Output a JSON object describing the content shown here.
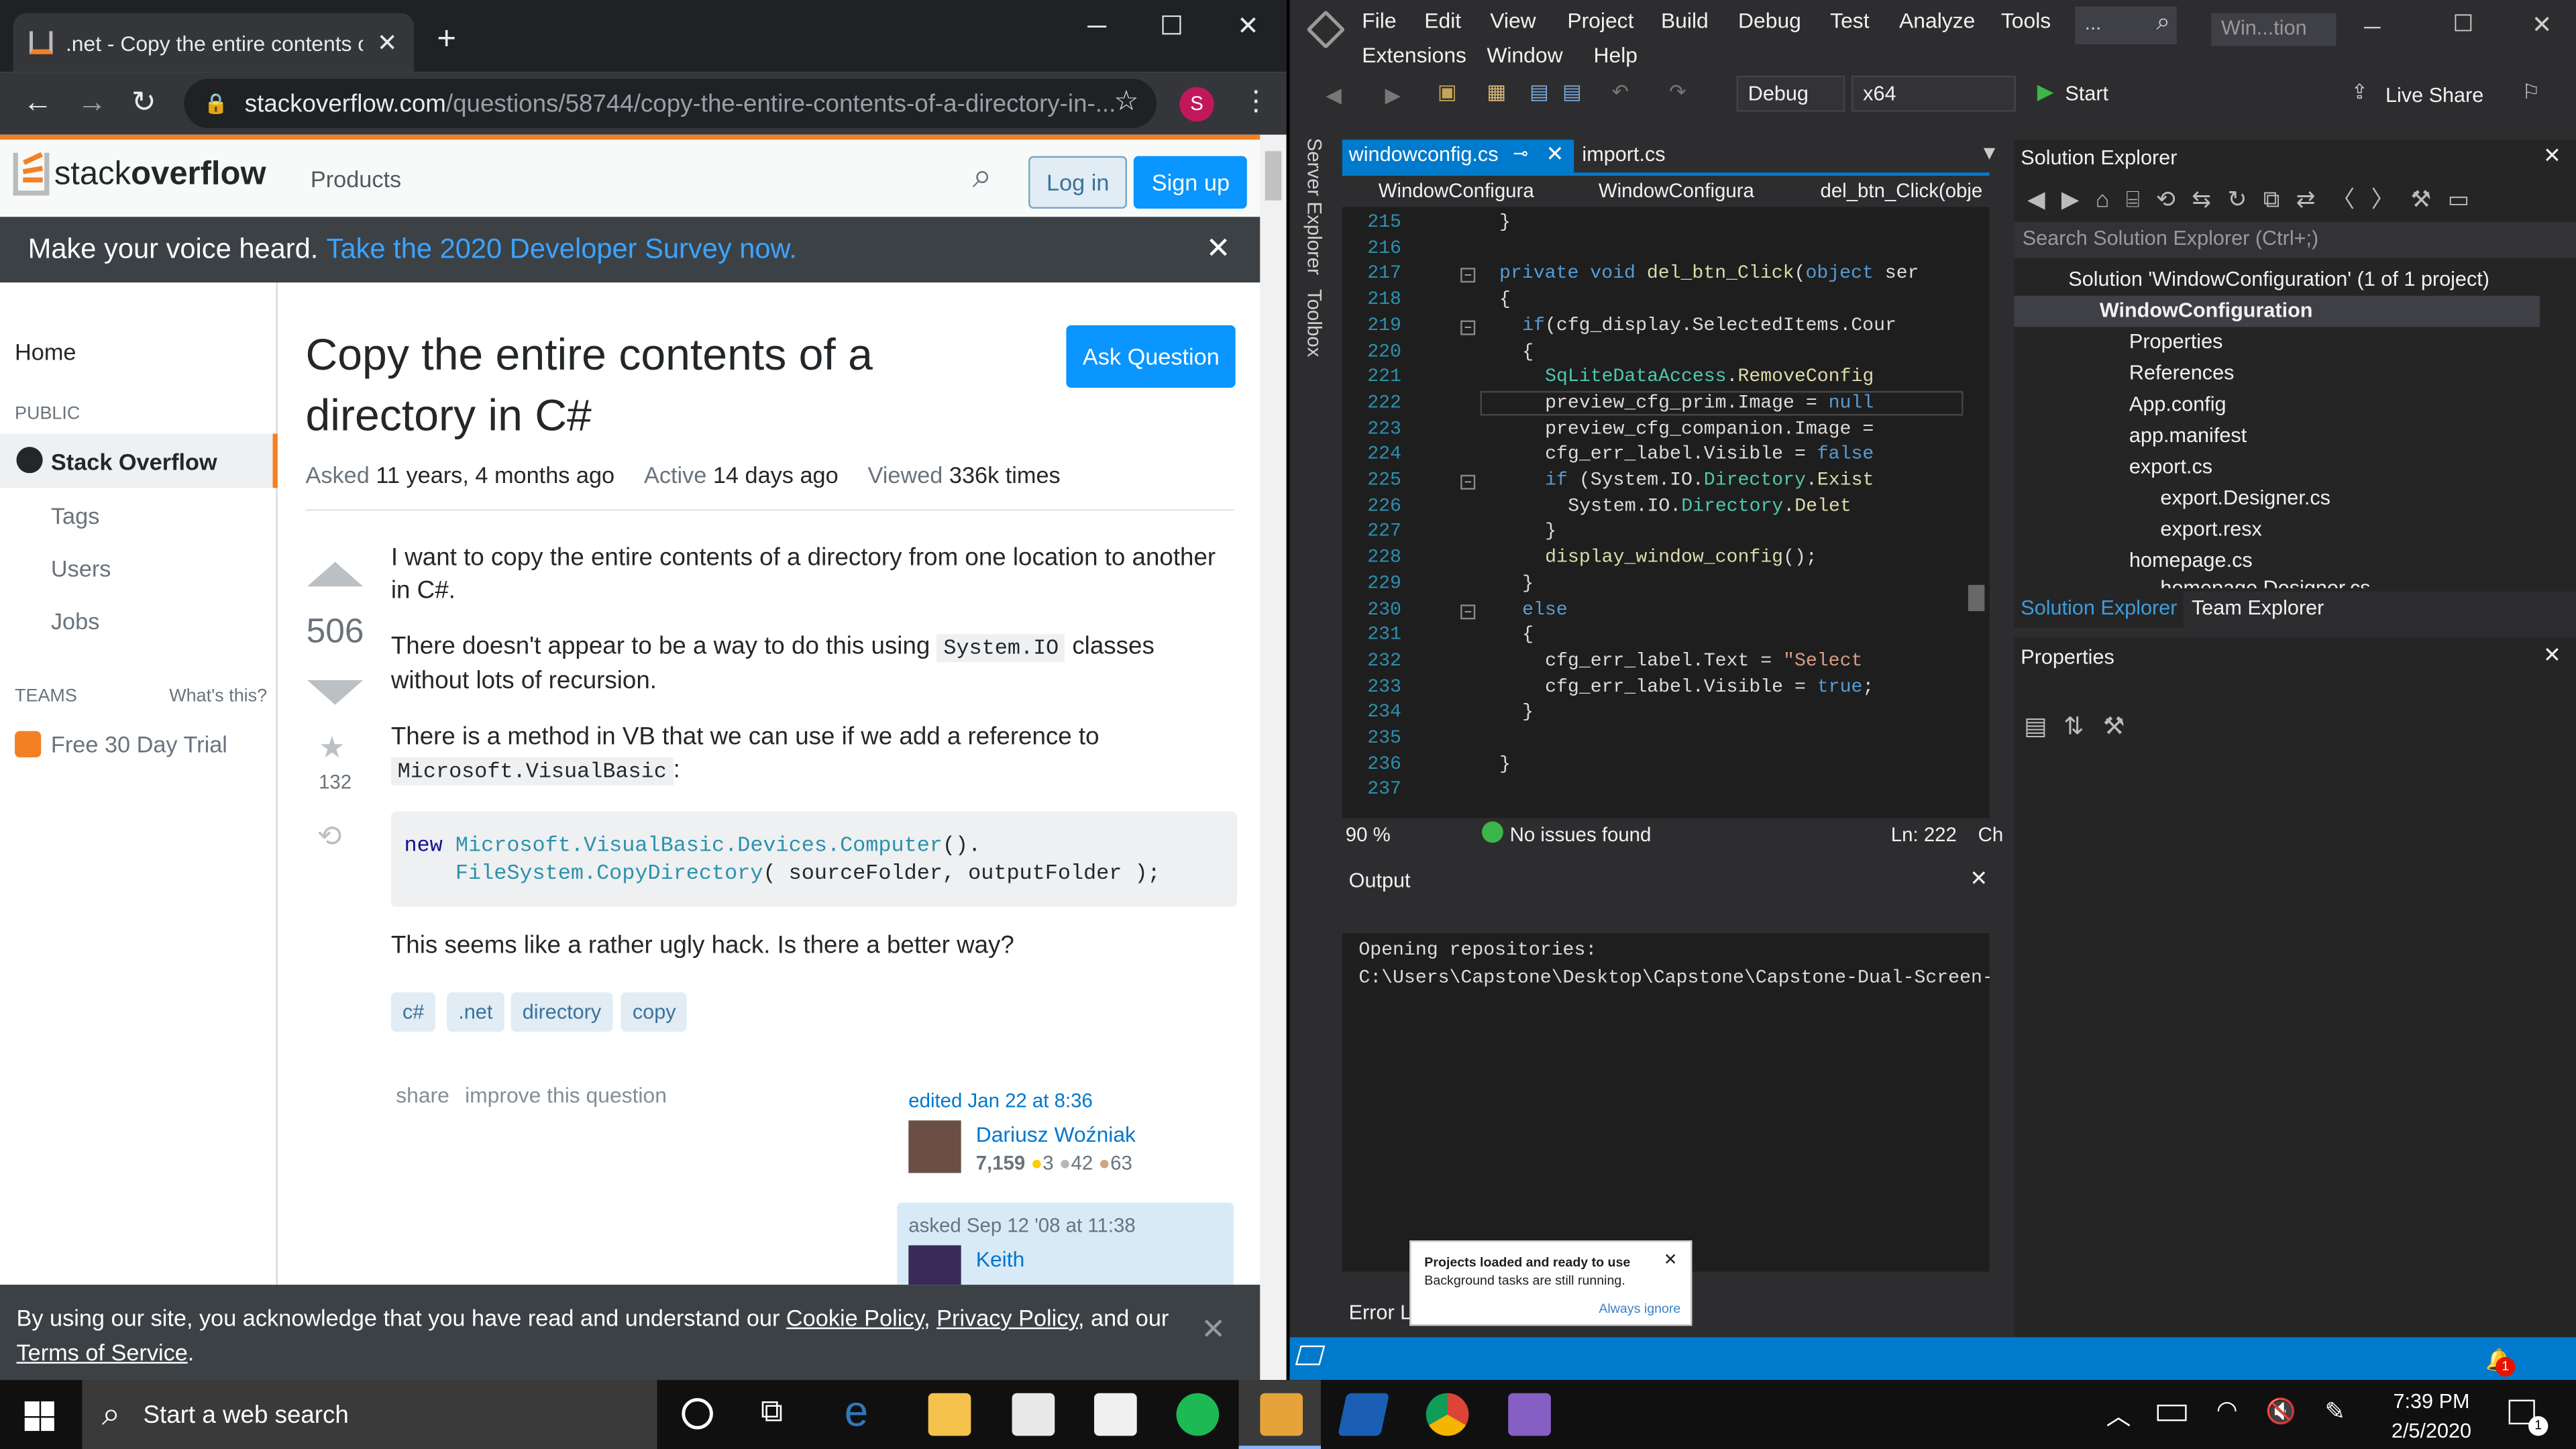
{
  "chrome": {
    "tab_title": ".net - Copy the entire contents of",
    "url_domain": "stackoverflow.com",
    "url_path": "/questions/58744/copy-the-entire-contents-of-a-directory-in-...",
    "profile_initial": "S"
  },
  "so": {
    "logo_light": "stack",
    "logo_bold": "overflow",
    "products": "Products",
    "login": "Log in",
    "signup": "Sign up",
    "banner_text": "Make your voice heard.",
    "banner_link": "Take the 2020 Developer Survey now.",
    "nav": {
      "home": "Home",
      "public": "PUBLIC",
      "stack_overflow": "Stack Overflow",
      "tags": "Tags",
      "users": "Users",
      "jobs": "Jobs",
      "teams": "TEAMS",
      "whats_this": "What's this?",
      "trial": "Free 30 Day Trial"
    },
    "question": {
      "title_line1": "Copy the entire contents of a",
      "title_line2": "directory in C#",
      "ask_button": "Ask Question",
      "asked_label": "Asked",
      "asked_value": "11 years, 4 months ago",
      "active_label": "Active",
      "active_value": "14 days ago",
      "viewed_label": "Viewed",
      "viewed_value": "336k times",
      "votes": "506",
      "favorites": "132",
      "p1": "I want to copy the entire contents of a directory from one location to another in C#.",
      "p2a": "There doesn't appear to be a way to do this using",
      "p2code": "System.IO",
      "p2b": "classes without lots of recursion.",
      "p3": "There is a method in VB that we can use if we add a reference to",
      "p3code": "Microsoft.VisualBasic",
      "p3end": ":",
      "code_new": "new",
      "code_ns": "Microsoft.VisualBasic.Devices.Computer",
      "code_l1end": "().",
      "code_fs": "FileSystem.CopyDirectory",
      "code_l2end": "( sourceFolder, outputFolder );",
      "p4": "This seems like a rather ugly hack. Is there a better way?",
      "tags": [
        "c#",
        ".net",
        "directory",
        "copy"
      ],
      "share": "share",
      "improve": "improve this question",
      "edited": "edited Jan 22 at 8:36",
      "editor_name": "Dariusz Woźniak",
      "editor_rep": "7,159",
      "editor_gold": "3",
      "editor_silver": "42",
      "editor_bronze": "63",
      "asked_on": "asked Sep 12 '08 at 11:38",
      "asker_name": "Keith"
    },
    "cookie": {
      "prefix": "By using our site, you acknowledge that you have read and understand our",
      "cookie_policy": "Cookie Policy",
      "privacy_policy": "Privacy Policy",
      "and_our": ", and our",
      "terms": "Terms of Service",
      "end": "."
    }
  },
  "vs": {
    "menu": [
      "File",
      "Edit",
      "View",
      "Project",
      "Build",
      "Debug",
      "Test",
      "Analyze",
      "Tools"
    ],
    "menu2": [
      "Extensions",
      "Window",
      "Help"
    ],
    "search_box": "...",
    "window_title": "Win...tion",
    "config": "Debug",
    "platform": "x64",
    "start": "Start",
    "live_share": "Live Share",
    "side_tabs": [
      "Server Explorer",
      "Toolbox"
    ],
    "tabs": [
      {
        "label": "windowconfig.cs",
        "active": true
      },
      {
        "label": "import.cs",
        "active": false
      }
    ],
    "nav_bar": [
      "WindowConfigura",
      "WindowConfigura",
      "del_btn_Click(obje"
    ],
    "code": [
      {
        "n": "215",
        "t": "}"
      },
      {
        "n": "216",
        "t": ""
      },
      {
        "n": "217",
        "t": "private void del_btn_Click(object ser"
      },
      {
        "n": "218",
        "t": "{"
      },
      {
        "n": "219",
        "t": "if(cfg_display.SelectedItems.Cour"
      },
      {
        "n": "220",
        "t": "{"
      },
      {
        "n": "221",
        "t": "SqLiteDataAccess.RemoveConfig"
      },
      {
        "n": "222",
        "t": "preview_cfg_prim.Image = null"
      },
      {
        "n": "223",
        "t": "preview_cfg_companion.Image ="
      },
      {
        "n": "224",
        "t": "cfg_err_label.Visible = false"
      },
      {
        "n": "225",
        "t": "if (System.IO.Directory.Exist"
      },
      {
        "n": "226",
        "t": "System.IO.Directory.Delet"
      },
      {
        "n": "227",
        "t": "}"
      },
      {
        "n": "228",
        "t": "display_window_config();"
      },
      {
        "n": "229",
        "t": "}"
      },
      {
        "n": "230",
        "t": "else"
      },
      {
        "n": "231",
        "t": "{"
      },
      {
        "n": "232",
        "t": "cfg_err_label.Text = \"Select"
      },
      {
        "n": "233",
        "t": "cfg_err_label.Visible = true;"
      },
      {
        "n": "234",
        "t": "}"
      },
      {
        "n": "235",
        "t": ""
      },
      {
        "n": "236",
        "t": "}"
      },
      {
        "n": "237",
        "t": ""
      }
    ],
    "zoom": "90 %",
    "issues": "No issues found",
    "line_col": "Ln: 222",
    "ch": "Ch",
    "output_title": "Output",
    "output_line1": "Opening repositories:",
    "output_line2": "C:\\Users\\Capstone\\Desktop\\Capstone\\Capstone-Dual-Screen-A",
    "error_list": "Error L",
    "toast_title": "Projects loaded and ready to use",
    "toast_body": "Background tasks are still running.",
    "toast_link": "Always ignore",
    "se_title": "Solution Explorer",
    "se_search": "Search Solution Explorer (Ctrl+;)",
    "se_tree": {
      "solution": "Solution 'WindowConfiguration' (1 of 1 project)",
      "project": "WindowConfiguration",
      "properties": "Properties",
      "references": "References",
      "app_config": "App.config",
      "app_manifest": "app.manifest",
      "export_cs": "export.cs",
      "export_designer": "export.Designer.cs",
      "export_resx": "export.resx",
      "homepage_cs": "homepage.cs",
      "homepage_designer": "homepage.Designer.cs"
    },
    "se_tab_active": "Solution Explorer",
    "se_tab_other": "Team Explorer",
    "props_title": "Properties",
    "notif_count": "1"
  },
  "taskbar": {
    "search": "Start a web search",
    "time": "7:39 PM",
    "date": "2/5/2020"
  }
}
